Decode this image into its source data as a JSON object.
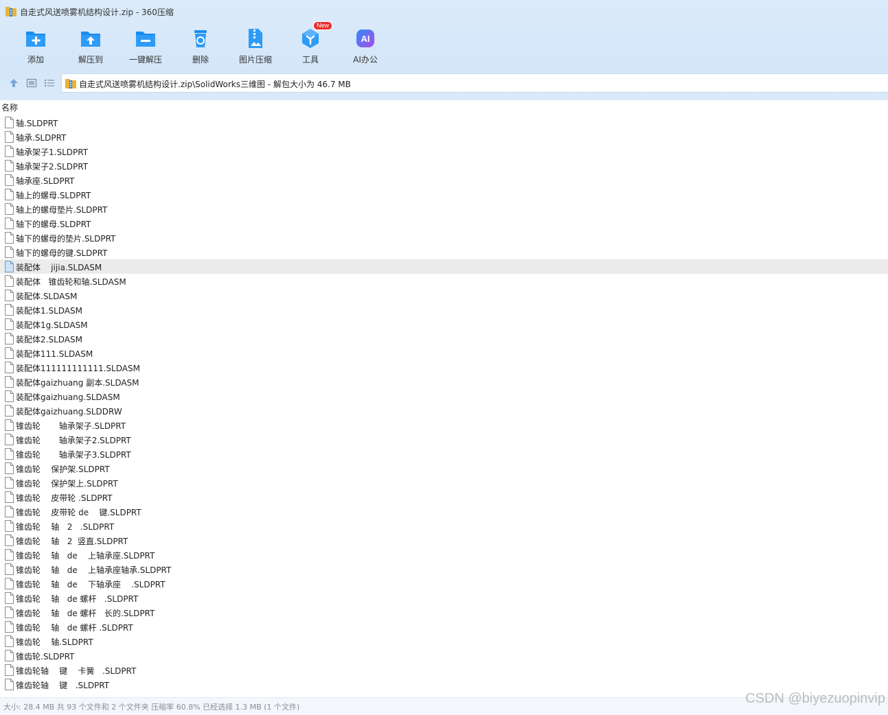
{
  "window": {
    "title": "自走式风送喷雾机结构设计.zip - 360压缩"
  },
  "toolbar": {
    "items": [
      {
        "label": "添加",
        "icon": "add-folder-icon"
      },
      {
        "label": "解压到",
        "icon": "extract-to-icon"
      },
      {
        "label": "一键解压",
        "icon": "one-click-extract-icon"
      },
      {
        "label": "删除",
        "icon": "delete-icon"
      },
      {
        "label": "图片压缩",
        "icon": "image-compress-icon"
      },
      {
        "label": "工具",
        "icon": "tools-icon",
        "badge": "New"
      },
      {
        "label": "AI办公",
        "icon": "ai-office-icon",
        "glyph": "AI"
      }
    ]
  },
  "address": {
    "path": "自走式风送喷雾机结构设计.zip\\SolidWorks三维图 - 解包大小为 46.7 MB"
  },
  "columns": {
    "name": "名称"
  },
  "files": [
    "轴.SLDPRT",
    "轴承.SLDPRT",
    "轴承架子1.SLDPRT",
    "轴承架子2.SLDPRT",
    "轴承座.SLDPRT",
    "轴上的螺母.SLDPRT",
    "轴上的螺母垫片.SLDPRT",
    "轴下的螺母.SLDPRT",
    "轴下的螺母的垫片.SLDPRT",
    "轴下的螺母的键.SLDPRT",
    "装配体    jijia.SLDASM",
    "装配体   锥齿轮和轴.SLDASM",
    "装配体.SLDASM",
    "装配体1.SLDASM",
    "装配体1g.SLDASM",
    "装配体2.SLDASM",
    "装配体111.SLDASM",
    "装配体111111111111.SLDASM",
    "装配体gaizhuang 副本.SLDASM",
    "装配体gaizhuang.SLDASM",
    "装配体gaizhuang.SLDDRW",
    "锥齿轮       轴承架子.SLDPRT",
    "锥齿轮       轴承架子2.SLDPRT",
    "锥齿轮       轴承架子3.SLDPRT",
    "锥齿轮    保护架.SLDPRT",
    "锥齿轮    保护架上.SLDPRT",
    "锥齿轮    皮带轮 .SLDPRT",
    "锥齿轮    皮带轮 de    键.SLDPRT",
    "锥齿轮    轴   2   .SLDPRT",
    "锥齿轮    轴   2  竖直.SLDPRT",
    "锥齿轮    轴   de    上轴承座.SLDPRT",
    "锥齿轮    轴   de    上轴承座轴承.SLDPRT",
    "锥齿轮    轴   de    下轴承座    .SLDPRT",
    "锥齿轮    轴   de 螺杆   .SLDPRT",
    "锥齿轮    轴   de 螺杆   长的.SLDPRT",
    "锥齿轮    轴   de 螺杆 .SLDPRT",
    "锥齿轮    轴.SLDPRT",
    "锥齿轮.SLDPRT",
    "锥齿轮轴    键    卡簧   .SLDPRT",
    "锥齿轮轴    键   .SLDPRT"
  ],
  "selected_file": "装配体    jijia.SLDASM",
  "status": {
    "text": "大小: 28.4 MB 共 93 个文件和 2 个文件夹 压缩率 60.8% 已经选择 1.3 MB (1 个文件)"
  },
  "watermark": "CSDN @biyezuopinvip",
  "colors": {
    "toolbar_bg": "#d7e8fa",
    "icon_blue": "#1a8cf0",
    "selection": "#ececec",
    "badge_red": "#ea2c2c"
  }
}
